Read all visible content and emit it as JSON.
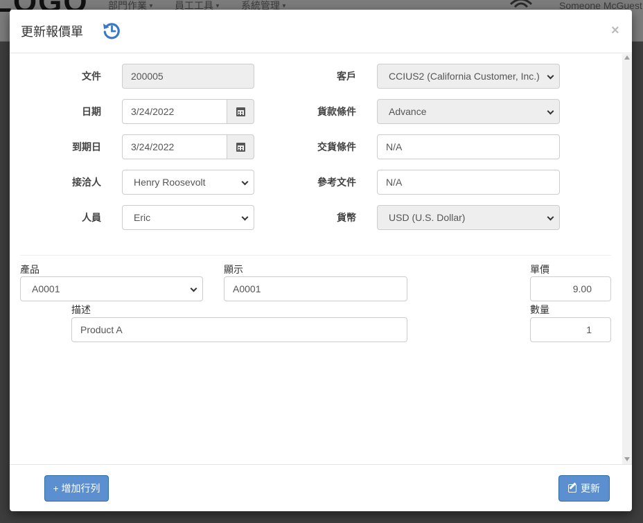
{
  "navbar": {
    "logo": "LOGO",
    "menus": [
      "部門作業",
      "員工工具",
      "系統管理"
    ],
    "user": "Someone McGuest"
  },
  "modal": {
    "title": "更新報價單",
    "close": "×",
    "fields": {
      "document": {
        "label": "文件",
        "value": "200005"
      },
      "date": {
        "label": "日期",
        "value": "3/24/2022"
      },
      "due_date": {
        "label": "到期日",
        "value": "3/24/2022"
      },
      "contact": {
        "label": "接洽人",
        "value": "Henry Roosevolt"
      },
      "staff": {
        "label": "人員",
        "value": "Eric"
      },
      "customer": {
        "label": "客戶",
        "value": "CCIUS2 (California Customer, Inc.)"
      },
      "payment_terms": {
        "label": "貨款條件",
        "value": "Advance"
      },
      "delivery_terms": {
        "label": "交貨條件",
        "value": "N/A"
      },
      "reference": {
        "label": "參考文件",
        "value": "N/A"
      },
      "currency": {
        "label": "貨幣",
        "value": "USD (U.S. Dollar)"
      }
    },
    "line": {
      "product": {
        "label": "產品",
        "value": "A0001"
      },
      "display": {
        "label": "顯示",
        "value": "A0001"
      },
      "unit_price": {
        "label": "單價",
        "value": "9.00"
      },
      "description": {
        "label": "描述",
        "value": "Product A"
      },
      "quantity": {
        "label": "數量",
        "value": "1"
      }
    },
    "buttons": {
      "add_row": "+ 增加行列",
      "update": "更新"
    }
  },
  "colors": {
    "primary_button": "#5b8fd0",
    "history_icon": "#3a79c5"
  }
}
